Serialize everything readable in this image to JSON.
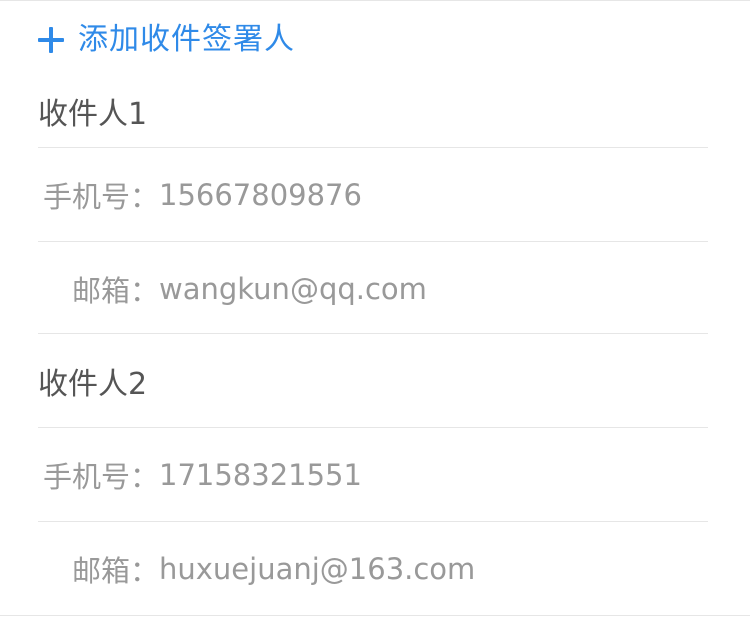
{
  "add_signer": {
    "label": "添加收件签署人",
    "icon": "plus-icon",
    "color": "#2f8ae8"
  },
  "recipients": [
    {
      "title": "收件人1",
      "phone_label": "手机号：",
      "phone": "15667809876",
      "email_label": "邮箱：",
      "email": "wangkun@qq.com"
    },
    {
      "title": "收件人2",
      "phone_label": "手机号：",
      "phone": "17158321551",
      "email_label": "邮箱：",
      "email": "huxuejuanj@163.com"
    }
  ]
}
